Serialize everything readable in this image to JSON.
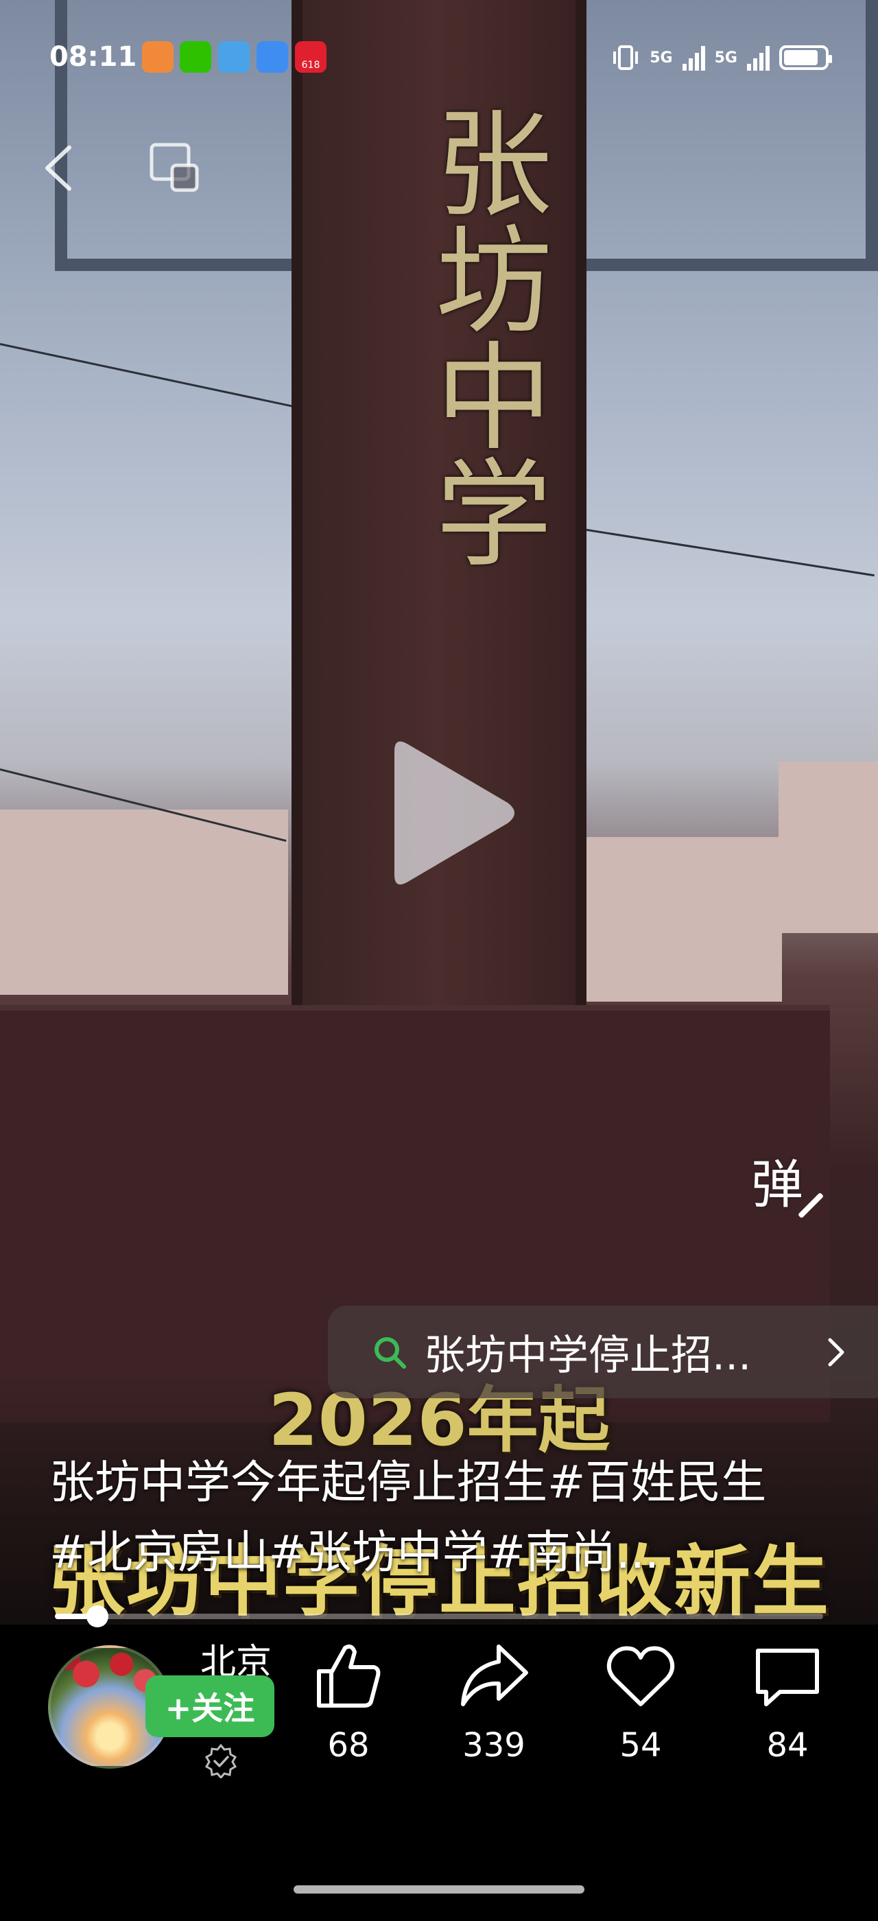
{
  "status_bar": {
    "time": "08:11",
    "network_1": "5G",
    "network_2": "5G",
    "app_badge": "618",
    "notification_icons": [
      "health-icon",
      "wechat-icon",
      "reader-icon",
      "weather-icon",
      "taobao-icon"
    ]
  },
  "video": {
    "pillar_text": "张坊中学",
    "caption_year": "2026年起",
    "caption_bottom": "张坊中学停止招收新生"
  },
  "search_chip": {
    "text": "张坊中学停止招..."
  },
  "danmaku": {
    "label": "弹"
  },
  "description": {
    "text": "张坊中学今年起停止招生#百姓民生#北京房山#张坊中学#南尚..."
  },
  "progress": {
    "fraction": 0.055
  },
  "author": {
    "name": "北京",
    "follow_label": "+关注"
  },
  "actions": {
    "like_count": "68",
    "share_count": "339",
    "favorite_count": "54",
    "comment_count": "84"
  },
  "colors": {
    "follow_green": "#3cbb55",
    "search_icon_green": "#3cbb55",
    "caption_gold": "#e7d36b"
  }
}
